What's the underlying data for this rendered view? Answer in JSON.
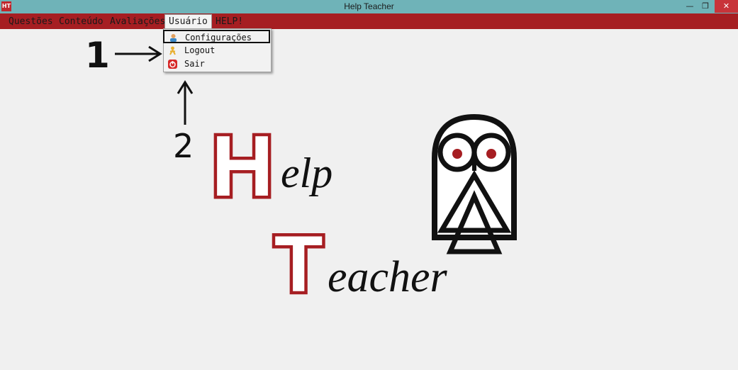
{
  "window": {
    "title": "Help Teacher",
    "app_icon_text": "HT",
    "minimize_glyph": "—",
    "maximize_glyph": "❐",
    "close_glyph": "✕"
  },
  "menubar": {
    "items": [
      {
        "label": "Questões"
      },
      {
        "label": "Conteúdo"
      },
      {
        "label": "Avaliações"
      },
      {
        "label": "Usuário"
      },
      {
        "label": "HELP!"
      }
    ]
  },
  "dropdown": {
    "items": [
      {
        "label": "Configurações",
        "icon": "user-settings-icon"
      },
      {
        "label": "Logout",
        "icon": "person-logout-icon"
      },
      {
        "label": "Sair",
        "icon": "power-icon"
      }
    ]
  },
  "annotations": {
    "one": "1",
    "two": "2"
  },
  "logo": {
    "help_initial": "H",
    "help_rest": "elp",
    "teacher_initial": "T",
    "teacher_rest": "eacher"
  },
  "colors": {
    "titlebar": "#6fb3b8",
    "menubar": "#a61e22",
    "brand_red": "#a61e22",
    "close_button": "#c8343a"
  }
}
